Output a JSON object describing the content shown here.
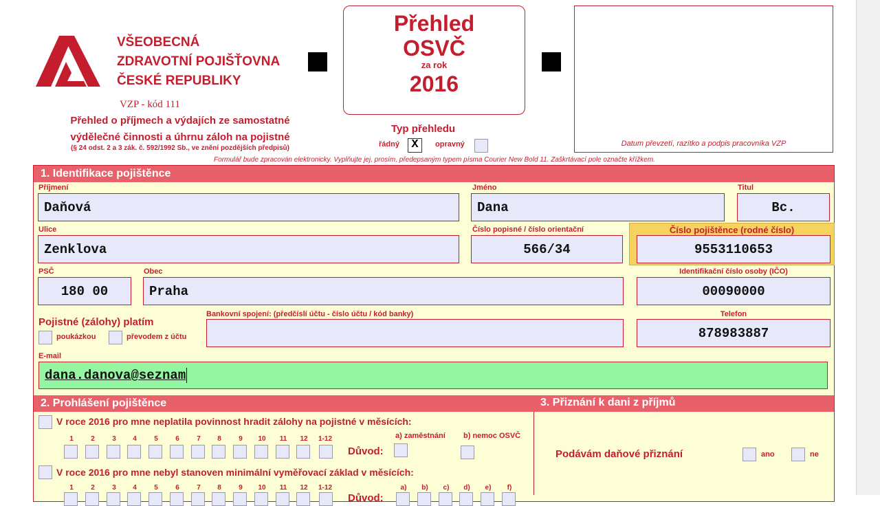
{
  "header": {
    "org_lines": [
      "VŠEOBECNÁ",
      "ZDRAVOTNÍ POJIŠŤOVNA",
      "ČESKÉ REPUBLIKY"
    ],
    "code": "VZP - kód 111",
    "form_title_1": "Přehled o příjmech a výdajích ze samostatné",
    "form_title_2": "výdělečné činnosti a úhrnu záloh na pojistné",
    "legal": "(§ 24 odst. 2 a 3 zák. č. 592/1992 Sb., ve znění pozdějších předpisů)",
    "box_title_1": "Přehled",
    "box_title_2": "OSVČ",
    "box_sub": "za rok",
    "box_year": "2016",
    "type_label": "Typ přehledu",
    "type_regular": "řádný",
    "type_regular_mark": "X",
    "type_corrective": "opravný",
    "stamp_caption": "Datum převzetí, razítko a podpis pracovníka VZP",
    "notice": "Formulář bude zpracován elektronicky. Vyplňujte jej, prosím, předepsaným typem písma Courier New Bold 11. Zaškrtávací pole označte křížkem."
  },
  "section1": {
    "title": "1. Identifikace pojištěnce",
    "surname_label": "Příjmení",
    "surname": "Daňová",
    "firstname_label": "Jméno",
    "firstname": "Dana",
    "titul_label": "Titul",
    "titul": "Bc.",
    "street_label": "Ulice",
    "street": "Zenklova",
    "house_label": "Číslo popisné / číslo orientační",
    "house": "566/34",
    "insured_no_label": "Číslo pojištěnce (rodné číslo)",
    "insured_no": "9553110653",
    "psc_label": "PSČ",
    "psc": "180 00",
    "city_label": "Obec",
    "city": "Praha",
    "ico_label": "Identifikační číslo osoby (IČO)",
    "ico": "00090000",
    "pay_label": "Pojistné (zálohy) platím",
    "pay_voucher": "poukázkou",
    "pay_transfer": "převodem z účtu",
    "bank_label": "Bankovní spojení: (předčíslí účtu - číslo účtu / kód banky)",
    "bank": "",
    "phone_label": "Telefon",
    "phone": "878983887",
    "email_label": "E-mail",
    "email": "dana.danova@seznam"
  },
  "section2": {
    "title": "2. Prohlášení pojištěnce",
    "line1": "V roce 2016 pro mne neplatila povinnost hradit zálohy na pojistné v měsících:",
    "line2": "V roce 2016 pro mne nebyl stanoven minimální vyměřovací základ v měsících:",
    "months": [
      "1",
      "2",
      "3",
      "4",
      "5",
      "6",
      "7",
      "8",
      "9",
      "10",
      "11",
      "12",
      "1-12"
    ],
    "reason_label": "Důvod:",
    "reason_a": "a) zaměstnání",
    "reason_b": "b) nemoc OSVČ",
    "reason_letters": [
      "a)",
      "b)",
      "c)",
      "d)",
      "e)",
      "f)"
    ]
  },
  "section3": {
    "title": "3. Přiznání k dani z příjmů",
    "question": "Podávám daňové přiznání",
    "yes": "ano",
    "no": "ne"
  },
  "colors": {
    "brand_red": "#c41e2e",
    "section_header": "#e8606a",
    "form_bg": "#fdfdd6",
    "field_bg": "#e8e8fb",
    "active_field": "#95f5a0",
    "highlight": "#f4d35e"
  }
}
